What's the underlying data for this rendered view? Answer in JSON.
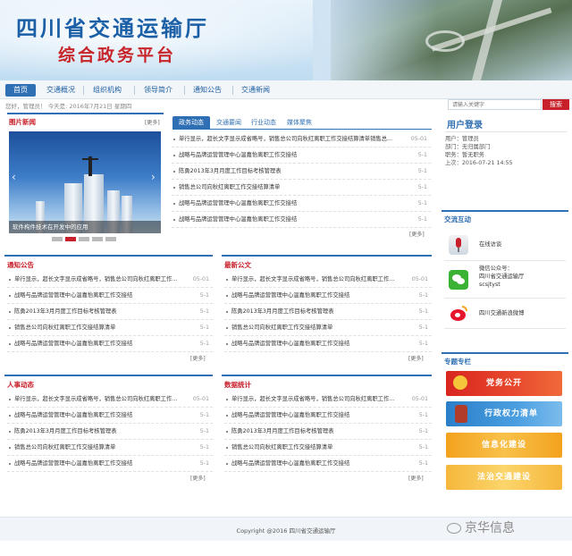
{
  "header": {
    "title": "四川省交通运输厅",
    "subtitle": "综合政务平台"
  },
  "nav": {
    "items": [
      "首页",
      "交通概况",
      "组织机构",
      "领导简介",
      "通知公告",
      "交通新闻"
    ]
  },
  "welcome": "您好，管理员！   今天是: 2016年7月21日 星期四",
  "search": {
    "placeholder": "请输入关键字",
    "button": "搜索"
  },
  "photo_news": {
    "title": "图片新闻",
    "more": "[更多]",
    "caption": "软件构件技术在开发中的应用",
    "slide_count": 5,
    "active_slide": 2
  },
  "tabs": [
    "政务动态",
    "交通要闻",
    "行业动态",
    "媒体聚焦"
  ],
  "main_news": {
    "more": "[更多]",
    "items": [
      {
        "t": "单行显示，超长文字显示成省略号，销售总公司向秋红离职工作交接结算清单销售总...",
        "d": "05-01"
      },
      {
        "t": "战略与品牌运营管理中心温嘉怡离职工作交接结",
        "d": "5-1"
      },
      {
        "t": "陈勇2013年3月月度工作目标考核管理表",
        "d": "5-1"
      },
      {
        "t": "销售总公司向秋红离职工作交接结算清单",
        "d": "5-1"
      },
      {
        "t": "战略与品牌运营管理中心温嘉怡离职工作交接结",
        "d": "5-1"
      },
      {
        "t": "战略与品牌运营管理中心温嘉怡离职工作交接结",
        "d": "5-1"
      }
    ]
  },
  "notice": {
    "title": "通知公告",
    "more": "[更多]",
    "items": [
      {
        "t": "单行显示，超长文字显示成省略号，销售总公司向秋红离职工作...",
        "d": "05-01"
      },
      {
        "t": "战略与品牌运营管理中心温嘉怡离职工作交接结",
        "d": "5-1"
      },
      {
        "t": "陈勇2013年3月月度工作目标考核管理表",
        "d": "5-1"
      },
      {
        "t": "销售总公司向秋红离职工作交接结算清单",
        "d": "5-1"
      },
      {
        "t": "战略与品牌运营管理中心温嘉怡离职工作交接结",
        "d": "5-1"
      }
    ]
  },
  "latest": {
    "title": "最新公文",
    "more": "[更多]",
    "items": [
      {
        "t": "单行显示，超长文字显示成省略号，销售总公司向秋红离职工作...",
        "d": "05-01"
      },
      {
        "t": "战略与品牌运营管理中心温嘉怡离职工作交接结",
        "d": "5-1"
      },
      {
        "t": "陈勇2013年3月月度工作目标考核管理表",
        "d": "5-1"
      },
      {
        "t": "销售总公司向秋红离职工作交接结算清单",
        "d": "5-1"
      },
      {
        "t": "战略与品牌运营管理中心温嘉怡离职工作交接结",
        "d": "5-1"
      }
    ]
  },
  "personnel": {
    "title": "人事动态",
    "more": "[更多]",
    "items": [
      {
        "t": "单行显示，超长文字显示成省略号，销售总公司向秋红离职工作...",
        "d": "05-01"
      },
      {
        "t": "战略与品牌运营管理中心温嘉怡离职工作交接结",
        "d": "5-1"
      },
      {
        "t": "陈勇2013年3月月度工作目标考核管理表",
        "d": "5-1"
      },
      {
        "t": "销售总公司向秋红离职工作交接结算清单",
        "d": "5-1"
      },
      {
        "t": "战略与品牌运营管理中心温嘉怡离职工作交接结",
        "d": "5-1"
      }
    ]
  },
  "stats": {
    "title": "数据统计",
    "more": "[更多]",
    "items": [
      {
        "t": "单行显示，超长文字显示成省略号，销售总公司向秋红离职工作...",
        "d": "05-01"
      },
      {
        "t": "战略与品牌运营管理中心温嘉怡离职工作交接结",
        "d": "5-1"
      },
      {
        "t": "陈勇2013年3月月度工作目标考核管理表",
        "d": "5-1"
      },
      {
        "t": "销售总公司向秋红离职工作交接结算清单",
        "d": "5-1"
      },
      {
        "t": "战略与品牌运营管理中心温嘉怡离职工作交接结",
        "d": "5-1"
      }
    ]
  },
  "login": {
    "title": "用户登录",
    "lines": [
      "用户：管理员",
      "部门：无归属部门",
      "职务：暂无职务",
      "上次：2016-07-21 14:55"
    ]
  },
  "contact": {
    "title": "交流互动",
    "online": "在线访谈",
    "wechat_label": "微信公众号：",
    "wechat_name": "四川省交通运输厅",
    "wechat_id": "scsjtyst",
    "weibo": "四川交通新浪微博"
  },
  "topics": {
    "title": "专题专栏",
    "items": [
      "党务公开",
      "行政权力清单",
      "信息化建设",
      "法治交通建设"
    ]
  },
  "footer": {
    "copyright": "Copyright @2016 四川省交通运输厅"
  },
  "watermark": "京华信息",
  "colors": {
    "primary": "#2f6fb3",
    "accent": "#c8202a"
  }
}
